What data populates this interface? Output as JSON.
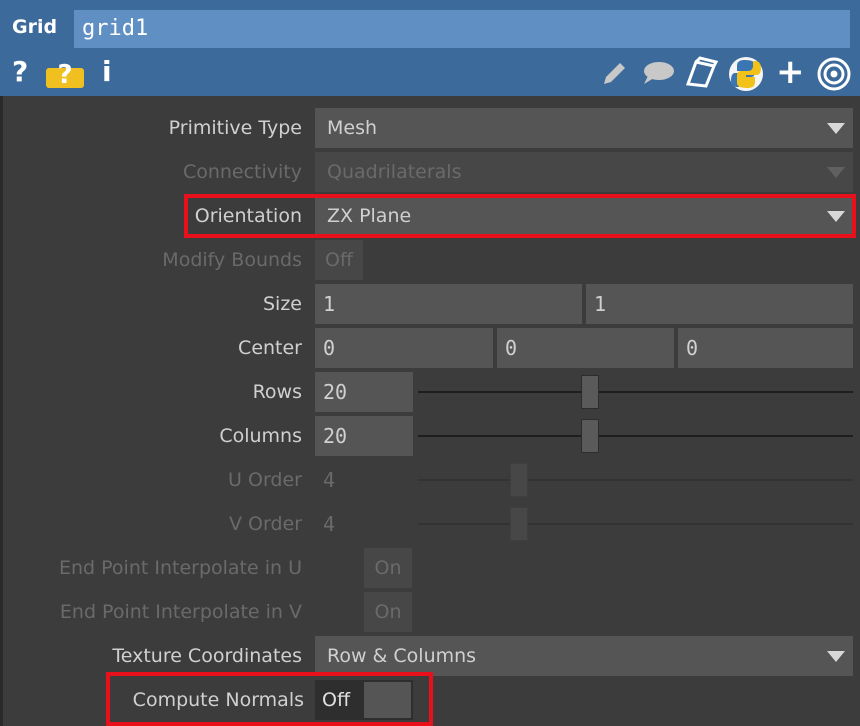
{
  "header": {
    "op_type": "Grid",
    "op_name": "grid1",
    "icons": [
      "help-icon",
      "python-help-icon",
      "info-icon",
      "edit-icon",
      "comment-icon",
      "clone-icon",
      "python-icon",
      "add-icon",
      "target-icon"
    ]
  },
  "params": {
    "primitive_type": {
      "label": "Primitive Type",
      "value": "Mesh"
    },
    "connectivity": {
      "label": "Connectivity",
      "value": "Quadrilaterals"
    },
    "orientation": {
      "label": "Orientation",
      "value": "ZX Plane"
    },
    "modify_bounds": {
      "label": "Modify Bounds",
      "value": "Off"
    },
    "size": {
      "label": "Size",
      "values": [
        "1",
        "1"
      ]
    },
    "center": {
      "label": "Center",
      "values": [
        "0",
        "0",
        "0"
      ]
    },
    "rows": {
      "label": "Rows",
      "value": "20"
    },
    "columns": {
      "label": "Columns",
      "value": "20"
    },
    "u_order": {
      "label": "U Order",
      "value": "4"
    },
    "v_order": {
      "label": "V Order",
      "value": "4"
    },
    "end_u": {
      "label": "End Point Interpolate in U",
      "value": "On"
    },
    "end_v": {
      "label": "End Point Interpolate in V",
      "value": "On"
    },
    "texture_coords": {
      "label": "Texture Coordinates",
      "value": "Row & Columns"
    },
    "compute_normals": {
      "label": "Compute Normals",
      "value": "Off"
    }
  },
  "colors": {
    "header_bg": "#3c6a9a",
    "panel_bg": "#3c3c3c",
    "field_bg": "#555555",
    "highlight": "#e8101a"
  }
}
